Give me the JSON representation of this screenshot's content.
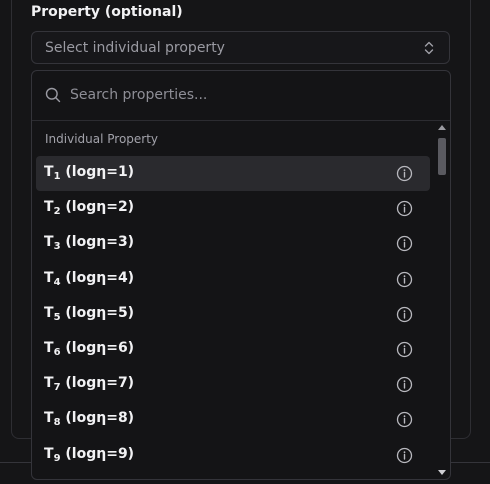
{
  "field": {
    "label": "Property (optional)",
    "placeholder": "Select individual property"
  },
  "search": {
    "placeholder": "Search properties..."
  },
  "group": {
    "heading": "Individual Property"
  },
  "items": [
    {
      "base": "T",
      "sub": "1",
      "rest": " (logη=1)",
      "active": true
    },
    {
      "base": "T",
      "sub": "2",
      "rest": " (logη=2)",
      "active": false
    },
    {
      "base": "T",
      "sub": "3",
      "rest": " (logη=3)",
      "active": false
    },
    {
      "base": "T",
      "sub": "4",
      "rest": " (logη=4)",
      "active": false
    },
    {
      "base": "T",
      "sub": "5",
      "rest": " (logη=5)",
      "active": false
    },
    {
      "base": "T",
      "sub": "6",
      "rest": " (logη=6)",
      "active": false
    },
    {
      "base": "T",
      "sub": "7",
      "rest": " (logη=7)",
      "active": false
    },
    {
      "base": "T",
      "sub": "8",
      "rest": " (logη=8)",
      "active": false
    },
    {
      "base": "T",
      "sub": "9",
      "rest": " (logη=9)",
      "active": false
    }
  ],
  "icons": {
    "trigger": "chevron-up-down-icon",
    "search": "search-icon",
    "item_action": "info-icon"
  }
}
